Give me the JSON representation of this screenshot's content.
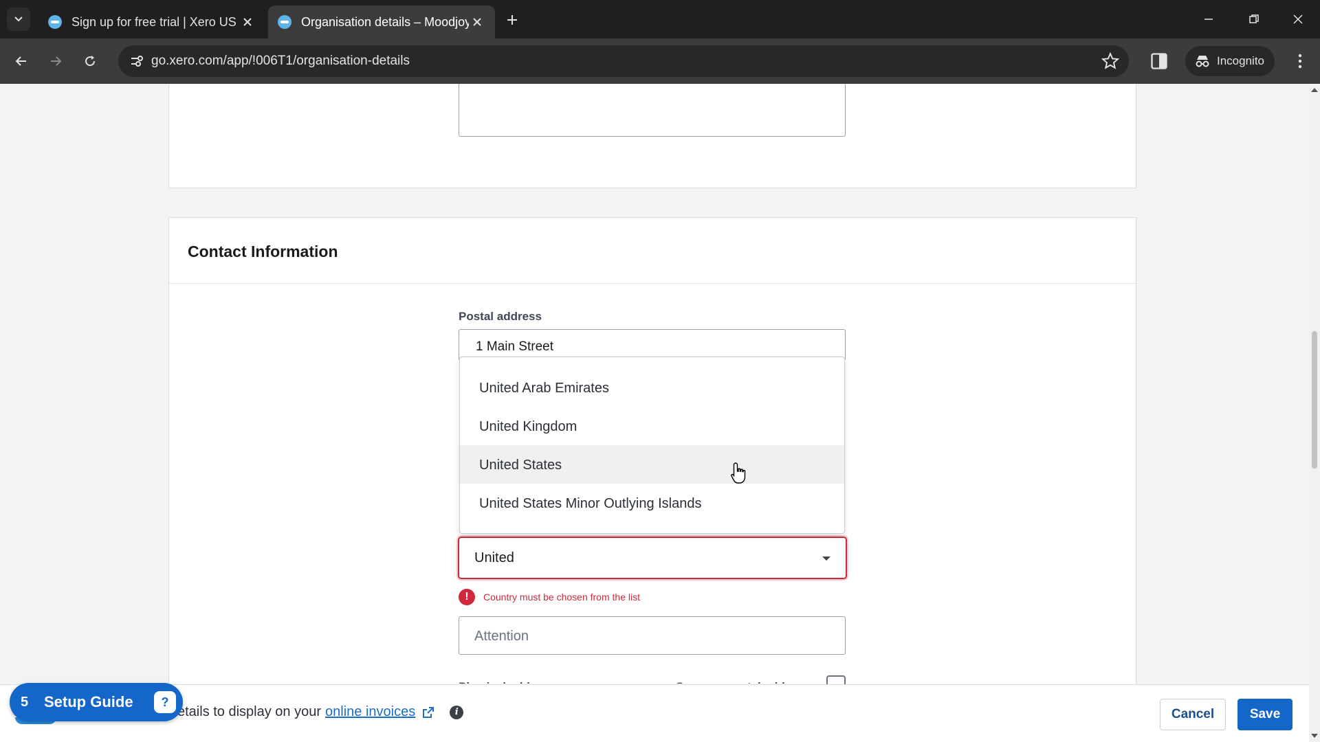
{
  "browser": {
    "tabs": [
      {
        "title": "Sign up for free trial | Xero US",
        "active": false
      },
      {
        "title": "Organisation details – Moodjoy",
        "active": true
      }
    ],
    "url": "go.xero.com/app/!006T1/organisation-details",
    "incognito_label": "Incognito"
  },
  "section": {
    "title": "Contact Information",
    "postal_label": "Postal address",
    "street_value": "1 Main Street"
  },
  "country_dropdown": {
    "options": [
      "United Arab Emirates",
      "United Kingdom",
      "United States",
      "United States Minor Outlying Islands"
    ],
    "hovered_index": 2,
    "input_value": "United",
    "error_text": "Country must be chosen from the list"
  },
  "attention": {
    "placeholder": "Attention"
  },
  "physical": {
    "label_fragment": "Physical address",
    "same_as_postal": "Same as postal address"
  },
  "footer": {
    "text_prefix": "etails to display on your",
    "link_text": "online invoices",
    "cancel_label": "Cancel",
    "save_label": "Save"
  },
  "setup_guide": {
    "count": "5",
    "label": "Setup Guide"
  },
  "colors": {
    "accent": "#1466c9",
    "error": "#c92a3e"
  }
}
